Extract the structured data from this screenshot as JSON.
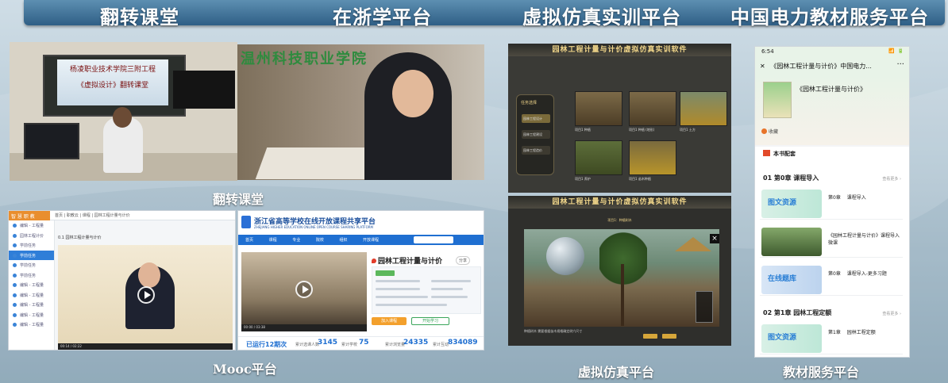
{
  "headers": [
    "翻转课堂",
    "在浙学平台",
    "虚拟仿真实训平台",
    "中国电力教材服务平台"
  ],
  "captions": {
    "flip": "翻转课堂",
    "mooc": "Mooc平台",
    "vr": "虚拟仿真平台",
    "textbook": "教材服务平台"
  },
  "classroom": {
    "screen_line1": "杨凌职业技术学院三附工程",
    "screen_line2": "《虚拟设计》翻转课堂"
  },
  "student_photo": {
    "sign": "温州科技职业学院"
  },
  "mooc_left": {
    "logo": "智 慧 职 教",
    "breadcrumb": "首页 | 职教云 | 课程 | 园林工程计量与计价",
    "lesson_title": "0.1 园林工程计量与计价",
    "side_items": [
      "编辑 - 工程量",
      "园林工程计价",
      "学前任务",
      "学前任务",
      "学前任务",
      "学前任务",
      "编辑 - 工程量",
      "编辑 - 工程量",
      "编辑 - 工程量",
      "编辑 - 工程量",
      "编辑 - 工程量"
    ],
    "time": "00:14 / 02:22"
  },
  "mooc_right": {
    "brand": "浙江省高等学校在线开放课程共享平台",
    "brand_sub": "ZHEJIANG HIGHER EDUCATION ONLINE OPEN COURSE SHARING PLATFORM",
    "nav": [
      "首页",
      "课程",
      "专业",
      "院校",
      "组织",
      "开放课程"
    ],
    "course_title": "园林工程计量与计价",
    "share": "分享",
    "btn_join": "加入课程",
    "btn_preview": "开始学习",
    "time": "00:00 / 03:38",
    "run_count": "已运行12期次",
    "stat1_label": "累计选课人数",
    "stat1_value": "3145",
    "stat2_label": "累计学校",
    "stat2_value": "75",
    "stat3_label": "累计浏览量",
    "stat3_value": "24335",
    "stat4_label": "累计互动",
    "stat4_value": "834089"
  },
  "vr_top": {
    "title": "园林工程计量与计价虚拟仿真实训软件",
    "menu_title": "任务选择",
    "menu": [
      "园林工程设计",
      "园林工程建设",
      "园林工程造价"
    ],
    "thumbs": [
      "项目1 种植",
      "项目1 种植 (地形)",
      "项目1 土方",
      "项目1 养护",
      "项目1 苗木种植"
    ]
  },
  "vr_bot": {
    "title": "园林工程计量与计价虚拟仿真实训软件",
    "sub": "项目1：种植树木",
    "bottom_text": "种植树木 需要根据苗木规格确定树穴尺寸"
  },
  "phone": {
    "time": "6:54",
    "status_icons": "📶 🔋",
    "header": "《园林工程计量与计价》中国电力...",
    "more": "···",
    "book_title": "《园林工程计量与计价》",
    "fav": "收藏",
    "section": "本书配套",
    "ch0": "01 第0章 课程导入",
    "ch0_more": "查看更多 ›",
    "ch1": "02 第1章 园林工程定额",
    "ch1_more": "查看更多 ›",
    "res": [
      {
        "label": "图文资源",
        "text": "第0章　 课程导入"
      },
      {
        "label": "",
        "text": "《园林工程计量与计价》课程导入微课"
      },
      {
        "label": "在线题库",
        "text": "第0章　 课程导入-更多习题"
      },
      {
        "label": "图文资源",
        "text": "第1章　 园林工程定额"
      }
    ]
  }
}
